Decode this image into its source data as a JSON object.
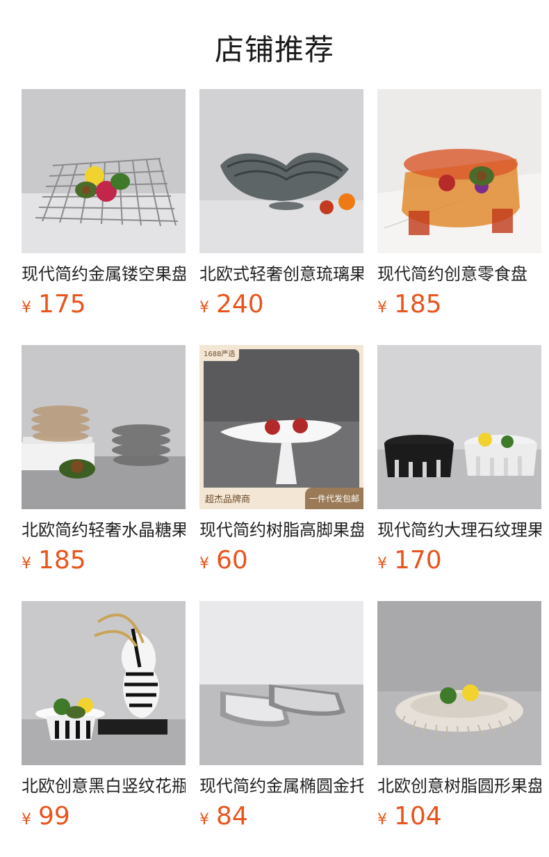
{
  "header": {
    "title": "店铺推荐"
  },
  "currency_symbol": "¥",
  "colors": {
    "price": "#e8541c"
  },
  "products": [
    {
      "title": "现代简约金属镂空果盘",
      "price": "175",
      "image": "metal-grid-fruit-tray"
    },
    {
      "title": "北欧式轻奢创意琉璃果盘",
      "price": "240",
      "image": "glass-shell-bowl"
    },
    {
      "title": "现代简约创意零食盘",
      "price": "185",
      "image": "amber-resin-bowl"
    },
    {
      "title": "北欧简约轻奢水晶糖果盘",
      "price": "185",
      "image": "crystal-stacked-dishes"
    },
    {
      "title": "现代简约树脂高脚果盘",
      "price": "60",
      "image": "white-pedestal-bowl",
      "badges": {
        "top_left": "1688严选",
        "bottom_left": "超杰品牌商",
        "bottom_right": "一件代发包邮"
      }
    },
    {
      "title": "现代简约大理石纹理果盘",
      "price": "170",
      "image": "marble-gear-trays"
    },
    {
      "title": "北欧创意黑白竖纹花瓶",
      "price": "99",
      "image": "striped-vase-set"
    },
    {
      "title": "现代简约金属椭圆金托盘",
      "price": "84",
      "image": "oval-metal-trays"
    },
    {
      "title": "北欧创意树脂圆形果盘",
      "price": "104",
      "image": "pleated-round-plate"
    }
  ]
}
